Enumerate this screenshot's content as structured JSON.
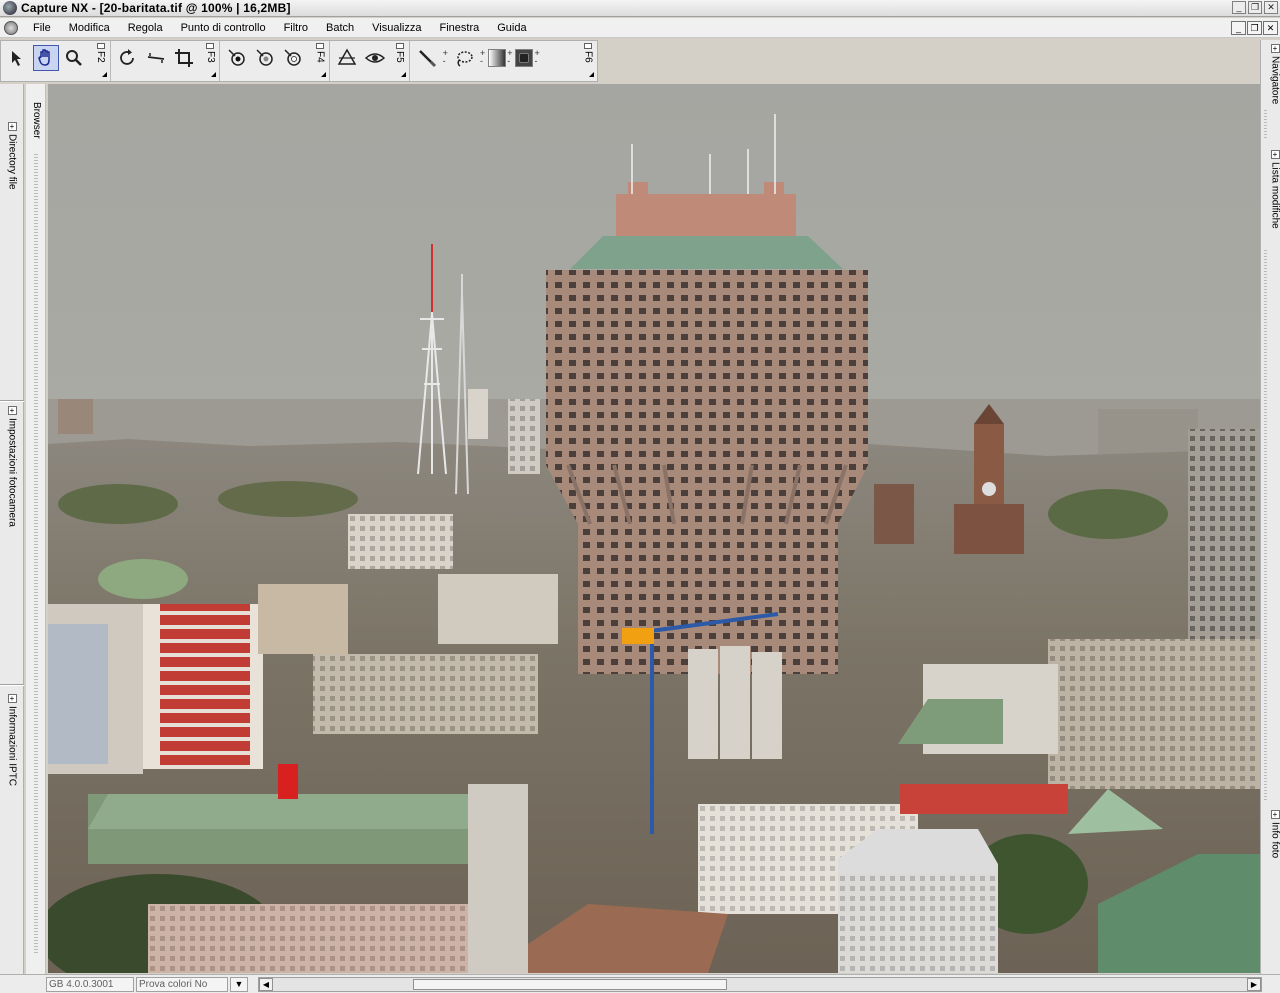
{
  "window": {
    "title": "Capture NX  - [20-baritata.tif @ 100% | 16,2MB]"
  },
  "menu": [
    "File",
    "Modifica",
    "Regola",
    "Punto di controllo",
    "Filtro",
    "Batch",
    "Visualizza",
    "Finestra",
    "Guida"
  ],
  "toolbar": {
    "f2": "F2",
    "f3": "F3",
    "f4": "F4",
    "f5": "F5",
    "f6": "F6"
  },
  "left_panel": {
    "directory": "Directory file",
    "camera": "Impostazioni fotocamera",
    "iptc": "Informazioni IPTC"
  },
  "browser_label": "Browser",
  "right_panel": {
    "navigator": "Navigatore",
    "edit_list": "Lista modifiche",
    "photo_info": "Info foto"
  },
  "status": {
    "color_profile": "GB 4.0.0.3001",
    "soft_proof": "Prova colori No"
  },
  "colors": {
    "sky": "#a9aaa5",
    "tower": "#a88a78",
    "roof_copper": "#7fa28c"
  }
}
